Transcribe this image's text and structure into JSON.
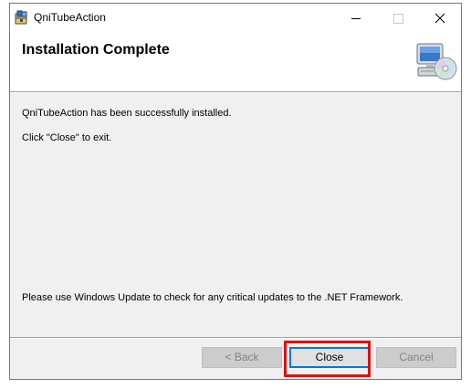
{
  "window": {
    "title": "QniTubeAction"
  },
  "titlebar": {
    "icons": [
      "installer-app-icon",
      "minimize-icon",
      "maximize-icon",
      "close-icon"
    ]
  },
  "header": {
    "title": "Installation Complete",
    "icon": "computer-cd-icon"
  },
  "body": {
    "line1": "QniTubeAction has been successfully installed.",
    "line2": "Click \"Close\" to exit.",
    "footer_note": "Please use Windows Update to check for any critical updates to the .NET Framework."
  },
  "buttons": {
    "back": {
      "label": "< Back",
      "enabled": false
    },
    "close": {
      "label": "Close",
      "enabled": true,
      "focused": true
    },
    "cancel": {
      "label": "Cancel",
      "enabled": false
    }
  },
  "colors": {
    "dialog_bg": "#f0f0f0",
    "header_bg": "#ffffff",
    "focus_border": "#0078d7",
    "highlight_box": "#e01010"
  }
}
